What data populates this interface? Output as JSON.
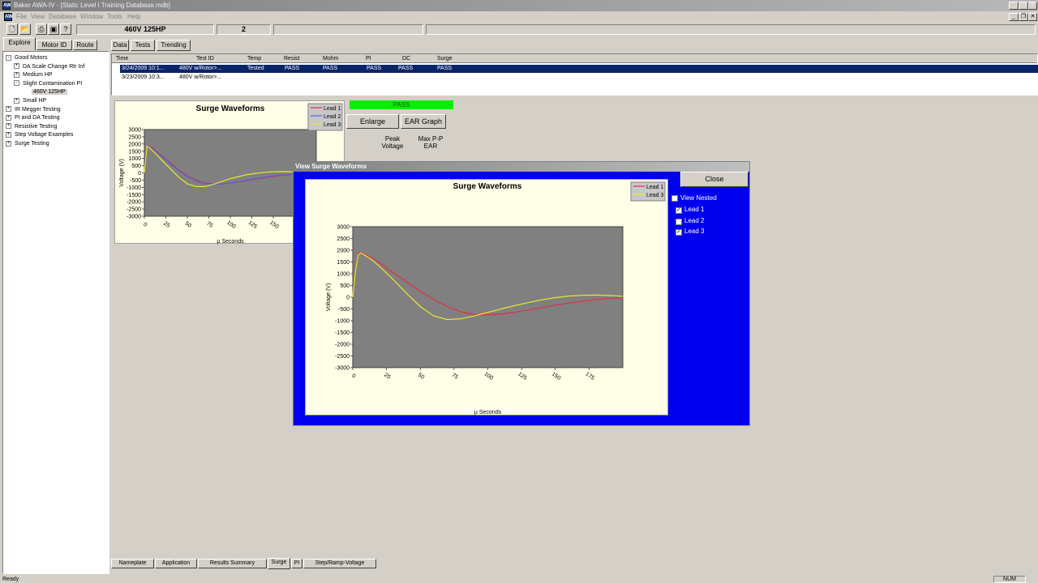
{
  "window": {
    "title": "Baker AWA-IV - [Static Level I Training Database.mdb]",
    "app_icon": "AW"
  },
  "menu": [
    "File",
    "View",
    "Database",
    "Window",
    "Tools",
    "Help"
  ],
  "toolbar": {
    "motor_field": "460V 125HP",
    "count_field": "2"
  },
  "left_tabs": [
    "Explore",
    "Motor ID",
    "Route"
  ],
  "data_tabs": [
    "Data",
    "Tests",
    "Trending"
  ],
  "tree": [
    {
      "label": "Good Motors",
      "expander": "-",
      "indent": 0
    },
    {
      "label": "DA Scale Change Rtr Inf",
      "expander": "+",
      "indent": 1
    },
    {
      "label": "Medium HP",
      "expander": "+",
      "indent": 1
    },
    {
      "label": "Slight Contamination PI",
      "expander": "-",
      "indent": 1
    },
    {
      "label": "460V 125HP",
      "expander": "",
      "indent": 2,
      "selected": true
    },
    {
      "label": "Small HP",
      "expander": "+",
      "indent": 1
    },
    {
      "label": "IR Megger Testing",
      "expander": "+",
      "indent": 0
    },
    {
      "label": "PI and DA Testing",
      "expander": "+",
      "indent": 0
    },
    {
      "label": "Resistive Testing",
      "expander": "+",
      "indent": 0
    },
    {
      "label": "Step Voltage Examples",
      "expander": "+",
      "indent": 0
    },
    {
      "label": "Surge Testing",
      "expander": "+",
      "indent": 0
    }
  ],
  "results_table": {
    "headers": [
      "Time",
      "Test ID",
      "Temp",
      "Resist",
      "Mohm",
      "PI",
      "DC",
      "Surge"
    ],
    "rows": [
      {
        "cells": [
          "3/24/2009 10:1...",
          "480V w/Rotor>...",
          "Tested",
          "PASS",
          "PASS",
          "PASS",
          "PASS",
          "PASS"
        ],
        "selected": true
      },
      {
        "cells": [
          "3/23/2009 10:3...",
          "480V w/Rotor>...",
          "",
          "",
          "",
          "",
          "",
          ""
        ],
        "selected": false
      }
    ]
  },
  "surge_panel": {
    "status": "PASS",
    "status_color": "#00f000",
    "enlarge_button": "Enlarge",
    "ear_button": "EAR Graph",
    "peak_voltage_label": "Peak Voltage",
    "max_pp_ear_label": "Max P-P EAR"
  },
  "bottom_tabs": [
    "Nameplate",
    "Application",
    "Results Summary",
    "Surge",
    "PI",
    "Step/Ramp-Voltage"
  ],
  "status": {
    "left": "Ready",
    "right": "NUM"
  },
  "dialog": {
    "title": "View Surge Waveforms",
    "close_button": "Close",
    "view_nested_label": "View Nested",
    "view_nested_checked": false,
    "lead_checkboxes": [
      {
        "label": "Lead 1",
        "checked": true
      },
      {
        "label": "Lead 2",
        "checked": false
      },
      {
        "label": "Lead 3",
        "checked": true
      }
    ]
  },
  "chart_data": [
    {
      "id": "small-surge-chart",
      "type": "line",
      "title": "Surge Waveforms",
      "xlabel": "µ Seconds",
      "ylabel": "Voltage (V)",
      "xlim": [
        0,
        200
      ],
      "ylim": [
        -3000,
        3000
      ],
      "xticks": [
        0,
        25,
        50,
        75,
        100,
        125,
        150
      ],
      "yticks": [
        3000,
        2500,
        2000,
        1500,
        1000,
        500,
        0,
        -500,
        -1000,
        -1500,
        -2000,
        -2500,
        -3000
      ],
      "legend": [
        "Lead 1",
        "Lead 2",
        "Lead 3"
      ],
      "legend_placement": "top-right",
      "series": [
        {
          "name": "Lead 1",
          "color": "#e03040",
          "x": [
            0,
            3,
            6,
            12,
            20,
            30,
            40,
            50,
            60,
            70,
            80,
            90,
            100,
            110,
            120,
            130,
            140,
            150,
            160,
            170,
            180,
            190,
            200
          ],
          "y": [
            0,
            1900,
            1850,
            1600,
            1200,
            700,
            200,
            -200,
            -500,
            -700,
            -780,
            -760,
            -700,
            -620,
            -520,
            -420,
            -330,
            -250,
            -180,
            -120,
            -80,
            -40,
            -20
          ]
        },
        {
          "name": "Lead 2",
          "color": "#5060e0",
          "x": [
            0,
            3,
            6,
            12,
            20,
            30,
            40,
            50,
            60,
            70,
            80,
            90,
            100,
            110,
            120,
            130,
            140,
            150,
            160,
            170,
            180,
            190,
            200
          ],
          "y": [
            0,
            1880,
            1800,
            1550,
            1150,
            650,
            150,
            -250,
            -550,
            -740,
            -800,
            -770,
            -700,
            -600,
            -500,
            -400,
            -300,
            -220,
            -150,
            -100,
            -60,
            -30,
            -10
          ]
        },
        {
          "name": "Lead 3",
          "color": "#e8e830",
          "x": [
            0,
            3,
            6,
            12,
            20,
            30,
            40,
            50,
            60,
            70,
            80,
            90,
            100,
            110,
            120,
            130,
            140,
            150,
            160,
            170,
            180,
            190,
            200
          ],
          "y": [
            0,
            1850,
            1750,
            1400,
            900,
            300,
            -300,
            -750,
            -950,
            -950,
            -800,
            -600,
            -400,
            -250,
            -120,
            -30,
            40,
            80,
            90,
            80,
            60,
            40,
            20
          ]
        }
      ]
    },
    {
      "id": "enlarged-surge-chart",
      "type": "line",
      "title": "Surge Waveforms",
      "xlabel": "µ Seconds",
      "ylabel": "Voltage (V)",
      "xlim": [
        0,
        200
      ],
      "ylim": [
        -3000,
        3000
      ],
      "xticks": [
        0,
        25,
        50,
        75,
        100,
        125,
        150,
        175
      ],
      "yticks": [
        3000,
        2500,
        2000,
        1500,
        1000,
        500,
        0,
        -500,
        -1000,
        -1500,
        -2000,
        -2500,
        -3000
      ],
      "legend": [
        "Lead 1",
        "Lead 3"
      ],
      "legend_placement": "top-right",
      "series": [
        {
          "name": "Lead 1",
          "color": "#e03040",
          "x": [
            0,
            2,
            4,
            6,
            10,
            15,
            20,
            30,
            40,
            50,
            60,
            70,
            80,
            90,
            100,
            110,
            120,
            130,
            140,
            150,
            160,
            170,
            180,
            190,
            200
          ],
          "y": [
            0,
            1200,
            1850,
            1900,
            1800,
            1650,
            1450,
            1050,
            650,
            250,
            -100,
            -400,
            -620,
            -740,
            -760,
            -720,
            -640,
            -540,
            -440,
            -340,
            -250,
            -170,
            -100,
            -50,
            -20
          ]
        },
        {
          "name": "Lead 3",
          "color": "#e8e830",
          "x": [
            0,
            2,
            4,
            6,
            10,
            15,
            20,
            30,
            40,
            50,
            60,
            70,
            80,
            90,
            100,
            110,
            120,
            130,
            140,
            150,
            160,
            170,
            180,
            190,
            200
          ],
          "y": [
            0,
            1100,
            1800,
            1880,
            1750,
            1550,
            1300,
            750,
            150,
            -400,
            -800,
            -950,
            -920,
            -800,
            -650,
            -500,
            -360,
            -230,
            -110,
            -20,
            50,
            80,
            90,
            70,
            40
          ]
        }
      ]
    }
  ]
}
